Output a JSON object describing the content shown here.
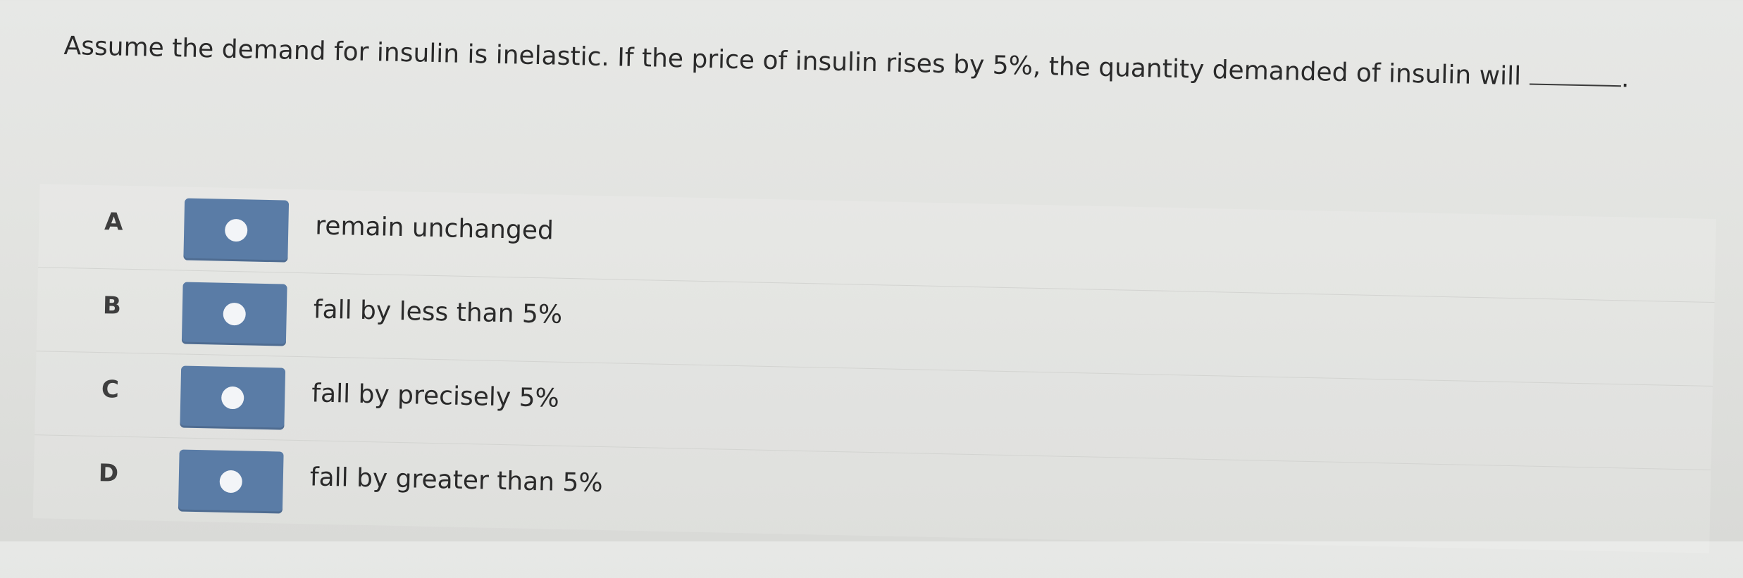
{
  "question": {
    "text": "Assume the demand for insulin is inelastic. If the price of insulin rises by 5%, the quantity demanded of insulin will",
    "suffix": "."
  },
  "options": [
    {
      "letter": "A",
      "text": "remain unchanged"
    },
    {
      "letter": "B",
      "text": "fall by less than 5%"
    },
    {
      "letter": "C",
      "text": "fall by precisely 5%"
    },
    {
      "letter": "D",
      "text": "fall by greater than 5%"
    }
  ],
  "colors": {
    "radio_button_bg": "#5a7ca6",
    "radio_dot": "#f3f5f8",
    "background": "#e2e3e0"
  }
}
